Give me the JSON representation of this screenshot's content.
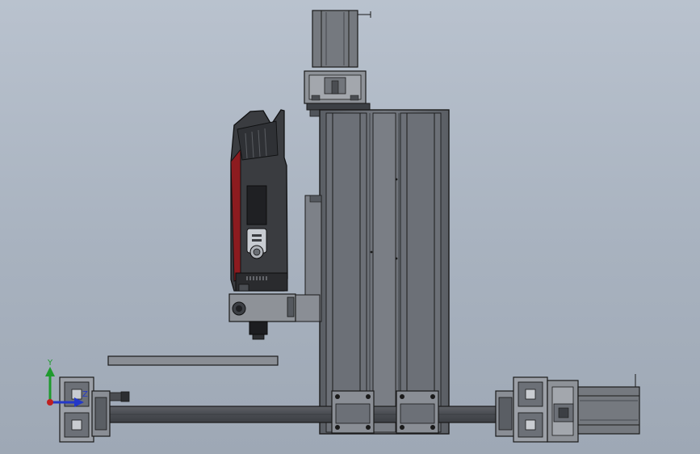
{
  "scene": {
    "description_free": true,
    "background_gradient": [
      "#b9c2ce",
      "#9ea8b5"
    ],
    "model": {
      "colors": {
        "aluminium": "#6f737a",
        "aluminium_light": "#8a8e95",
        "edge": "#1a1a1a",
        "spindle_body": "#3a3c40",
        "spindle_accent": "#8c1b1f"
      }
    }
  },
  "triad": {
    "y_label": "Y",
    "z_label": "Z",
    "y_color": "#1f9a2e",
    "z_color": "#2438c8",
    "x_color": "#c0201f"
  }
}
